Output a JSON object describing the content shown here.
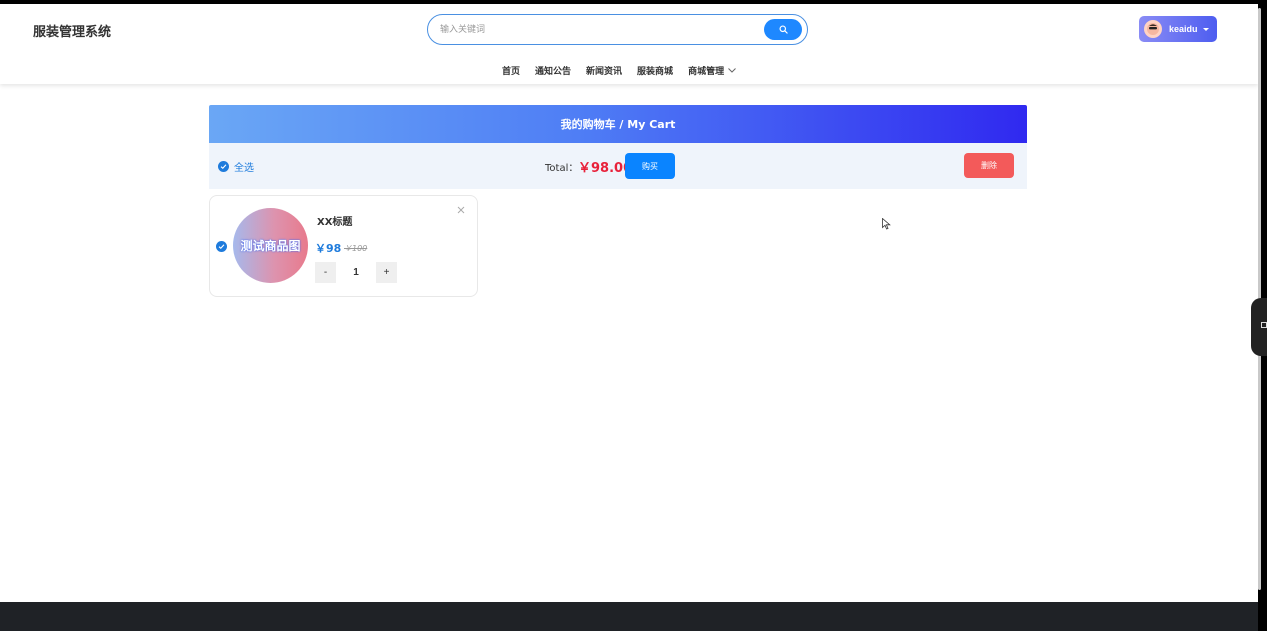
{
  "app": {
    "title": "服装管理系统"
  },
  "search": {
    "placeholder": "输入关键词",
    "value": ""
  },
  "user": {
    "name": "keaidu"
  },
  "nav": {
    "items": [
      {
        "label": "首页"
      },
      {
        "label": "通知公告"
      },
      {
        "label": "新闻资讯"
      },
      {
        "label": "服装商城"
      },
      {
        "label": "商城管理",
        "has_dropdown": true
      }
    ]
  },
  "cart": {
    "title": "我的购物车 / My Cart",
    "select_all_label": "全选",
    "total_label": "Total：",
    "total_value": "￥98.00",
    "buy_label": "购买",
    "delete_label": "删除",
    "items": [
      {
        "image_text": "测试商品图",
        "title": "XX标题",
        "price": "￥98",
        "original_price": "￥100",
        "quantity": "1",
        "minus_label": "-",
        "plus_label": "+",
        "checked": true
      }
    ]
  },
  "colors": {
    "accent": "#1e7bdc",
    "buy": "#0a84ff",
    "delete": "#f35a5a",
    "total": "#e8213a",
    "footer": "#1f2226"
  },
  "icons": {
    "search": "search-icon",
    "close": "close-icon",
    "check": "check-circle-icon",
    "dropdown": "chevron-down-icon",
    "avatar": "avatar-icon"
  }
}
